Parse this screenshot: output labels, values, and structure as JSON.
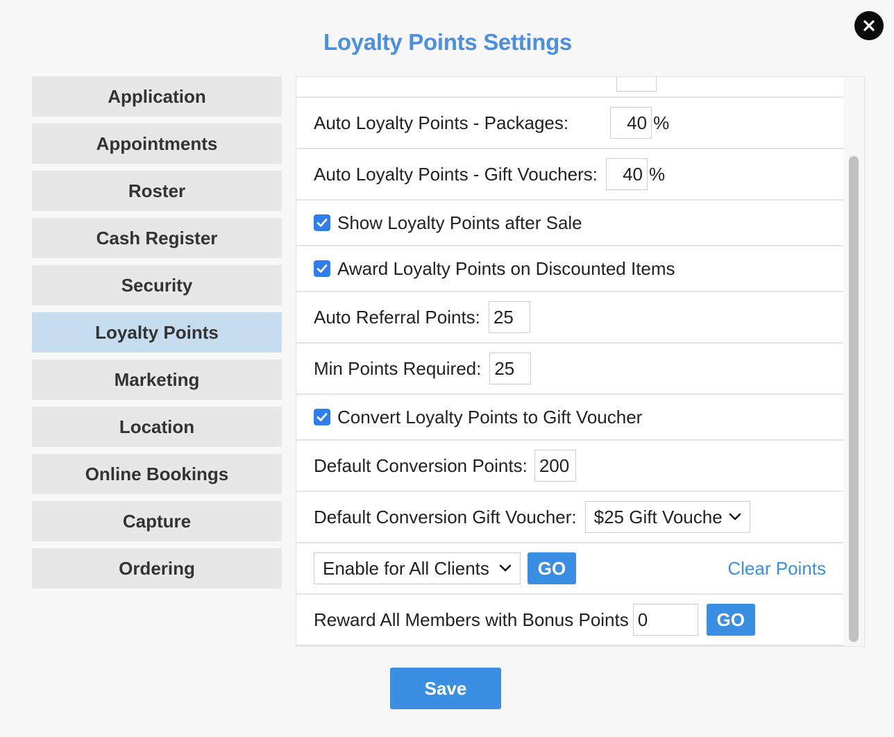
{
  "title": "Loyalty Points Settings",
  "colors": {
    "accent": "#3b8fe3",
    "active_tab": "#c6dcef",
    "tab": "#e7e7e7"
  },
  "sidebar": {
    "items": [
      {
        "label": "Application"
      },
      {
        "label": "Appointments"
      },
      {
        "label": "Roster"
      },
      {
        "label": "Cash Register"
      },
      {
        "label": "Security"
      },
      {
        "label": "Loyalty Points",
        "active": true
      },
      {
        "label": "Marketing"
      },
      {
        "label": "Location"
      },
      {
        "label": "Online Bookings"
      },
      {
        "label": "Capture"
      },
      {
        "label": "Ordering"
      }
    ]
  },
  "settings": {
    "packages": {
      "label": "Auto Loyalty Points - Packages:",
      "value": "40",
      "unit": "%"
    },
    "gift_vouchers": {
      "label": "Auto Loyalty Points - Gift Vouchers:",
      "value": "40",
      "unit": "%"
    },
    "show_after_sale": {
      "label": "Show Loyalty Points after Sale",
      "checked": true
    },
    "award_discounted": {
      "label": "Award Loyalty Points on Discounted Items",
      "checked": true
    },
    "referral": {
      "label": "Auto Referral Points:",
      "value": "25"
    },
    "min_points": {
      "label": "Min Points Required:",
      "value": "25"
    },
    "convert_to_voucher": {
      "label": "Convert Loyalty Points to Gift Voucher",
      "checked": true
    },
    "conversion_points": {
      "label": "Default Conversion Points:",
      "value": "200"
    },
    "conversion_voucher": {
      "label": "Default Conversion Gift Voucher:",
      "selected": "$25 Gift Vouche"
    },
    "enable_clients": {
      "selected": "Enable for All Clients",
      "go": "GO",
      "clear": "Clear Points"
    },
    "bonus": {
      "label": "Reward All Members with Bonus Points",
      "value": "0",
      "go": "GO"
    }
  },
  "icons": {
    "close": "close-icon",
    "check": "check-icon",
    "chevron": "chevron-down-icon"
  },
  "save_label": "Save"
}
